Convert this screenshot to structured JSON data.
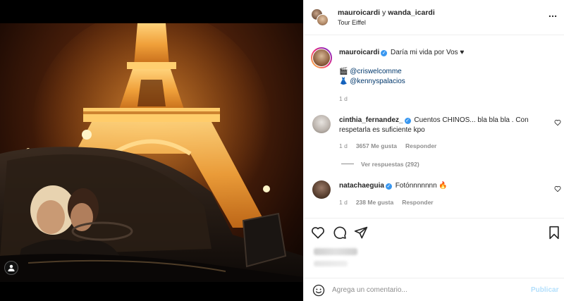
{
  "post": {
    "users": "mauroicardi",
    "conj": "y",
    "user2": "wanda_icardi",
    "location": "Tour Eiffel"
  },
  "caption": {
    "username": "mauroicardi",
    "text": "Daría mi vida por Vos ♥",
    "credit1_emoji": "🎬",
    "credit1": "@criswelcomme",
    "credit2_emoji": "👗",
    "credit2": "@kennyspalacios",
    "time": "1 d"
  },
  "comments": [
    {
      "username": "cinthia_fernandez_",
      "text": "Cuentos CHINOS... bla bla bla . Con respetarla es suficiente kpo",
      "time": "1 d",
      "likes": "3657 Me gusta",
      "reply": "Responder"
    },
    {
      "username": "natachaeguia",
      "text": "Fotónnnnnnn 🔥",
      "time": "1 d",
      "likes": "238 Me gusta",
      "reply": "Responder"
    }
  ],
  "view_replies": "Ver respuestas (292)",
  "composer": {
    "placeholder": "Agrega un comentario...",
    "publish": "Publicar"
  },
  "colors": {
    "verified": "#3897f0",
    "publish": "#b2dffc",
    "secondary_text": "#8e8e8e"
  }
}
